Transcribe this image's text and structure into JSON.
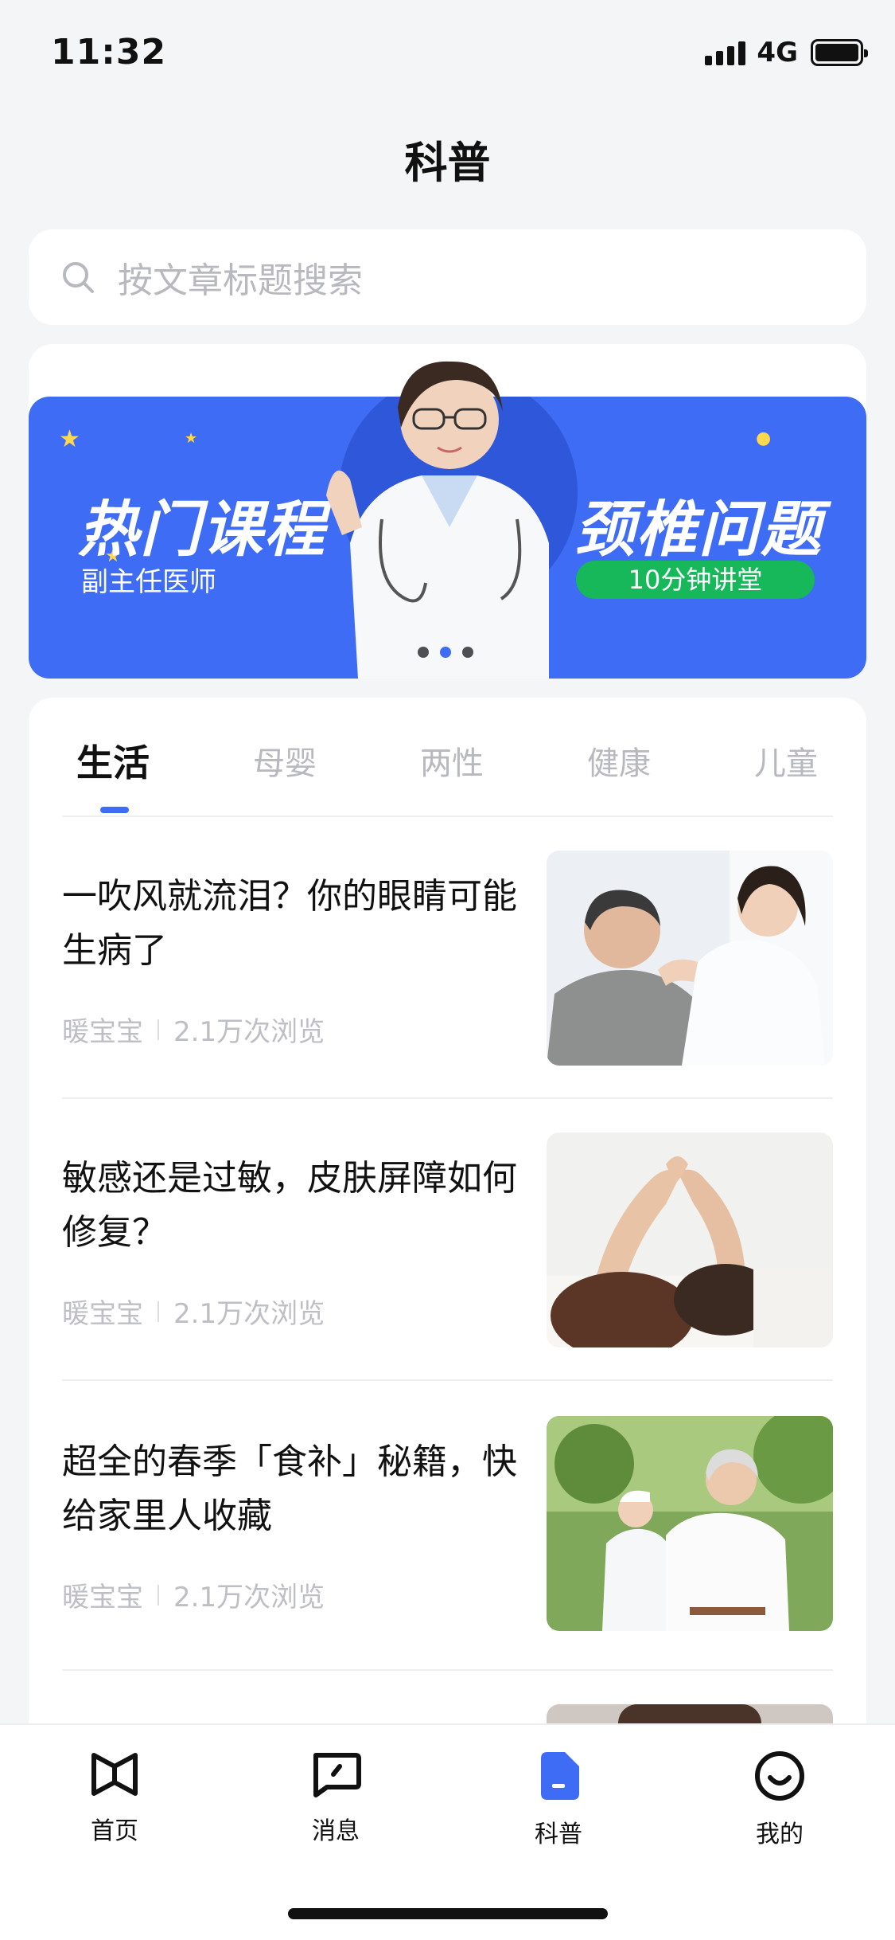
{
  "status_bar": {
    "time": "11:32",
    "network": "4G"
  },
  "page": {
    "title": "科普"
  },
  "search": {
    "placeholder": "按文章标题搜索"
  },
  "banner": {
    "left_title": "热门课程",
    "left_subtitle": "副主任医师",
    "right_title": "颈椎问题",
    "right_pill": "10分钟讲堂",
    "slide_count": 3,
    "active_slide": 2
  },
  "tabs": [
    {
      "label": "生活",
      "active": true
    },
    {
      "label": "母婴",
      "active": false
    },
    {
      "label": "两性",
      "active": false
    },
    {
      "label": "健康",
      "active": false
    },
    {
      "label": "儿童",
      "active": false
    }
  ],
  "articles": [
    {
      "title": "一吹风就流泪？你的眼睛可能生病了",
      "author": "暖宝宝",
      "views": "2.1万次浏览"
    },
    {
      "title": "敏感还是过敏，皮肤屏障如何修复？",
      "author": "暖宝宝",
      "views": "2.1万次浏览"
    },
    {
      "title": "超全的春季「食补」秘籍，快给家里人收藏",
      "author": "暖宝宝",
      "views": "2.1万次浏览"
    }
  ],
  "tab_bar": [
    {
      "label": "首页",
      "icon": "bowtie-icon",
      "active": false
    },
    {
      "label": "消息",
      "icon": "message-icon",
      "active": false
    },
    {
      "label": "科普",
      "icon": "document-icon",
      "active": true
    },
    {
      "label": "我的",
      "icon": "smiley-icon",
      "active": false
    }
  ],
  "colors": {
    "accent": "#3f6cf5",
    "green": "#16b85a",
    "background": "#f4f5f7"
  }
}
